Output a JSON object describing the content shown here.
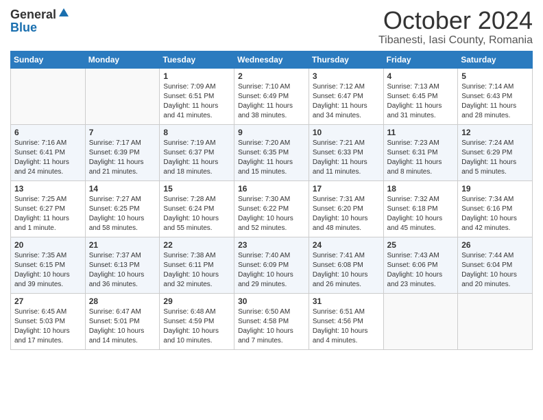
{
  "logo": {
    "general": "General",
    "blue": "Blue"
  },
  "title": {
    "month": "October 2024",
    "location": "Tibanesti, Iasi County, Romania"
  },
  "weekdays": [
    "Sunday",
    "Monday",
    "Tuesday",
    "Wednesday",
    "Thursday",
    "Friday",
    "Saturday"
  ],
  "weeks": [
    [
      {
        "day": "",
        "info": ""
      },
      {
        "day": "",
        "info": ""
      },
      {
        "day": "1",
        "info": "Sunrise: 7:09 AM\nSunset: 6:51 PM\nDaylight: 11 hours and 41 minutes."
      },
      {
        "day": "2",
        "info": "Sunrise: 7:10 AM\nSunset: 6:49 PM\nDaylight: 11 hours and 38 minutes."
      },
      {
        "day": "3",
        "info": "Sunrise: 7:12 AM\nSunset: 6:47 PM\nDaylight: 11 hours and 34 minutes."
      },
      {
        "day": "4",
        "info": "Sunrise: 7:13 AM\nSunset: 6:45 PM\nDaylight: 11 hours and 31 minutes."
      },
      {
        "day": "5",
        "info": "Sunrise: 7:14 AM\nSunset: 6:43 PM\nDaylight: 11 hours and 28 minutes."
      }
    ],
    [
      {
        "day": "6",
        "info": "Sunrise: 7:16 AM\nSunset: 6:41 PM\nDaylight: 11 hours and 24 minutes."
      },
      {
        "day": "7",
        "info": "Sunrise: 7:17 AM\nSunset: 6:39 PM\nDaylight: 11 hours and 21 minutes."
      },
      {
        "day": "8",
        "info": "Sunrise: 7:19 AM\nSunset: 6:37 PM\nDaylight: 11 hours and 18 minutes."
      },
      {
        "day": "9",
        "info": "Sunrise: 7:20 AM\nSunset: 6:35 PM\nDaylight: 11 hours and 15 minutes."
      },
      {
        "day": "10",
        "info": "Sunrise: 7:21 AM\nSunset: 6:33 PM\nDaylight: 11 hours and 11 minutes."
      },
      {
        "day": "11",
        "info": "Sunrise: 7:23 AM\nSunset: 6:31 PM\nDaylight: 11 hours and 8 minutes."
      },
      {
        "day": "12",
        "info": "Sunrise: 7:24 AM\nSunset: 6:29 PM\nDaylight: 11 hours and 5 minutes."
      }
    ],
    [
      {
        "day": "13",
        "info": "Sunrise: 7:25 AM\nSunset: 6:27 PM\nDaylight: 11 hours and 1 minute."
      },
      {
        "day": "14",
        "info": "Sunrise: 7:27 AM\nSunset: 6:25 PM\nDaylight: 10 hours and 58 minutes."
      },
      {
        "day": "15",
        "info": "Sunrise: 7:28 AM\nSunset: 6:24 PM\nDaylight: 10 hours and 55 minutes."
      },
      {
        "day": "16",
        "info": "Sunrise: 7:30 AM\nSunset: 6:22 PM\nDaylight: 10 hours and 52 minutes."
      },
      {
        "day": "17",
        "info": "Sunrise: 7:31 AM\nSunset: 6:20 PM\nDaylight: 10 hours and 48 minutes."
      },
      {
        "day": "18",
        "info": "Sunrise: 7:32 AM\nSunset: 6:18 PM\nDaylight: 10 hours and 45 minutes."
      },
      {
        "day": "19",
        "info": "Sunrise: 7:34 AM\nSunset: 6:16 PM\nDaylight: 10 hours and 42 minutes."
      }
    ],
    [
      {
        "day": "20",
        "info": "Sunrise: 7:35 AM\nSunset: 6:15 PM\nDaylight: 10 hours and 39 minutes."
      },
      {
        "day": "21",
        "info": "Sunrise: 7:37 AM\nSunset: 6:13 PM\nDaylight: 10 hours and 36 minutes."
      },
      {
        "day": "22",
        "info": "Sunrise: 7:38 AM\nSunset: 6:11 PM\nDaylight: 10 hours and 32 minutes."
      },
      {
        "day": "23",
        "info": "Sunrise: 7:40 AM\nSunset: 6:09 PM\nDaylight: 10 hours and 29 minutes."
      },
      {
        "day": "24",
        "info": "Sunrise: 7:41 AM\nSunset: 6:08 PM\nDaylight: 10 hours and 26 minutes."
      },
      {
        "day": "25",
        "info": "Sunrise: 7:43 AM\nSunset: 6:06 PM\nDaylight: 10 hours and 23 minutes."
      },
      {
        "day": "26",
        "info": "Sunrise: 7:44 AM\nSunset: 6:04 PM\nDaylight: 10 hours and 20 minutes."
      }
    ],
    [
      {
        "day": "27",
        "info": "Sunrise: 6:45 AM\nSunset: 5:03 PM\nDaylight: 10 hours and 17 minutes."
      },
      {
        "day": "28",
        "info": "Sunrise: 6:47 AM\nSunset: 5:01 PM\nDaylight: 10 hours and 14 minutes."
      },
      {
        "day": "29",
        "info": "Sunrise: 6:48 AM\nSunset: 4:59 PM\nDaylight: 10 hours and 10 minutes."
      },
      {
        "day": "30",
        "info": "Sunrise: 6:50 AM\nSunset: 4:58 PM\nDaylight: 10 hours and 7 minutes."
      },
      {
        "day": "31",
        "info": "Sunrise: 6:51 AM\nSunset: 4:56 PM\nDaylight: 10 hours and 4 minutes."
      },
      {
        "day": "",
        "info": ""
      },
      {
        "day": "",
        "info": ""
      }
    ]
  ]
}
